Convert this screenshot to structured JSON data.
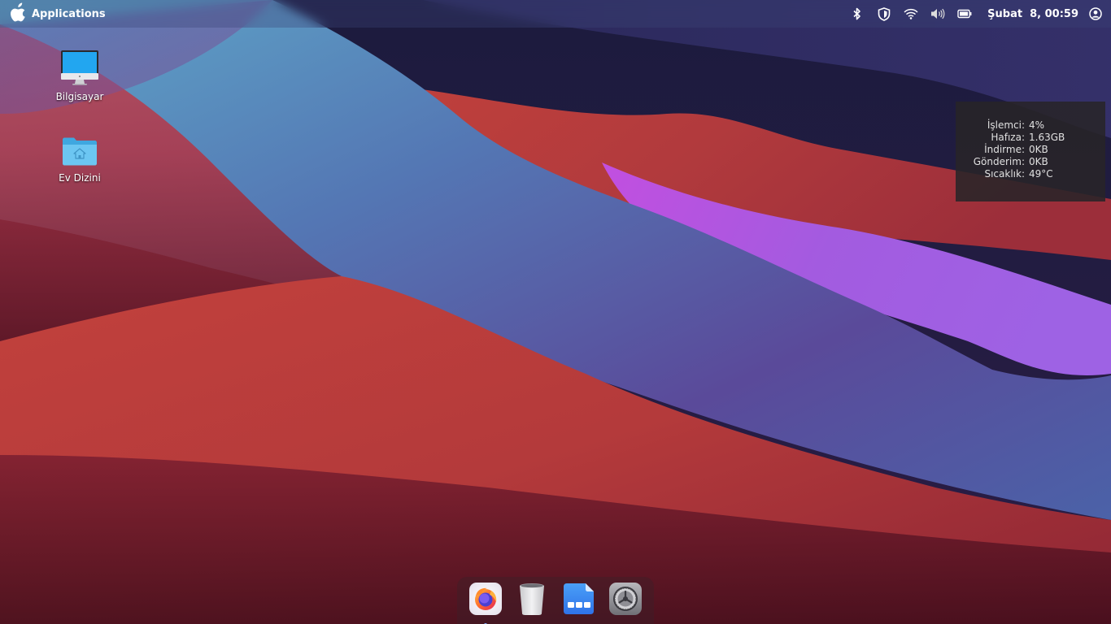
{
  "top_panel": {
    "apps_label": "Applications",
    "clock": "Şubat  8, 00:59",
    "tray_icons": [
      "bluetooth-icon",
      "shield-icon",
      "wifi-icon",
      "volume-icon",
      "battery-icon"
    ],
    "user_icon": "user-account-icon"
  },
  "desktop": {
    "icons": [
      {
        "label": "Bilgisayar",
        "icon": "computer-icon"
      },
      {
        "label": "Ev Dizini",
        "icon": "home-folder-icon"
      }
    ]
  },
  "sysmon": {
    "rows": [
      {
        "key": "İşlemci:",
        "value": "4%"
      },
      {
        "key": "Hafıza:",
        "value": "1.63GB"
      },
      {
        "key": "İndirme:",
        "value": "0KB"
      },
      {
        "key": "Gönderim:",
        "value": "0KB"
      },
      {
        "key": "Sıcaklık:",
        "value": "49°C"
      }
    ]
  },
  "dock": {
    "items": [
      {
        "icon": "firefox-icon",
        "running": true
      },
      {
        "icon": "trash-icon",
        "running": false
      },
      {
        "icon": "file-manager-icon",
        "running": false
      },
      {
        "icon": "system-settings-icon",
        "running": false
      }
    ]
  },
  "colors": {
    "accent": "#7fb0ff",
    "wallpaper_red": "#b8393a",
    "wallpaper_blue": "#5e9ec4",
    "wallpaper_violet": "#a35be0",
    "wallpaper_navy": "#1e1d44"
  }
}
